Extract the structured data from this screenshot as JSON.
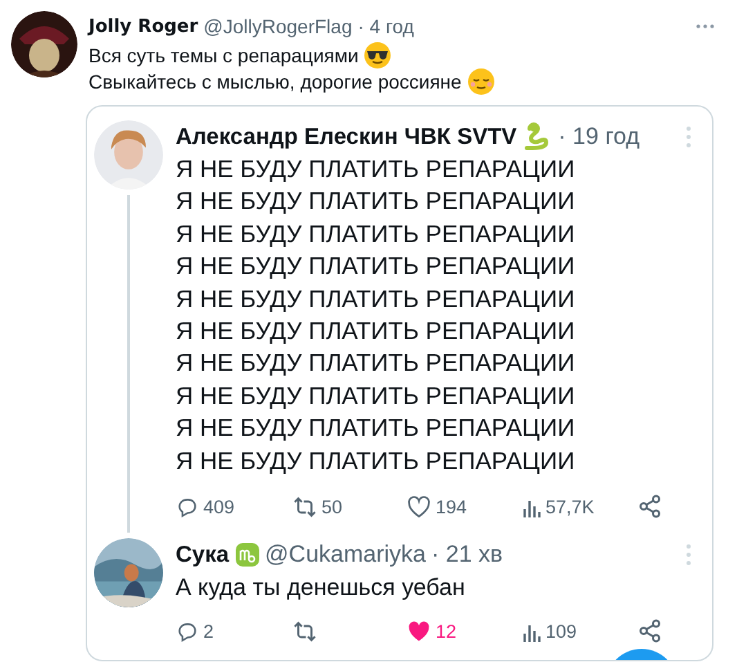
{
  "post": {
    "author": "Jolly Roger",
    "handle": "@JollyRogerFlag",
    "time": "· 4 год",
    "lines": [
      "Вся суть темы с репарациями",
      "Свыкайтесь с мыслью, дорогие россияне"
    ]
  },
  "quoted": {
    "author": "Александр Елескин ЧВК SVTV",
    "time": "· 19 год",
    "lines": [
      "Я НЕ БУДУ ПЛАТИТЬ РЕПАРАЦИИ",
      "Я НЕ БУДУ ПЛАТИТЬ РЕПАРАЦИИ",
      "Я НЕ БУДУ ПЛАТИТЬ РЕПАРАЦИИ",
      "Я НЕ БУДУ ПЛАТИТЬ РЕПАРАЦИИ",
      "Я НЕ БУДУ ПЛАТИТЬ РЕПАРАЦИИ",
      "Я НЕ БУДУ ПЛАТИТЬ РЕПАРАЦИИ",
      "Я НЕ БУДУ ПЛАТИТЬ РЕПАРАЦИИ",
      "Я НЕ БУДУ ПЛАТИТЬ РЕПАРАЦИИ",
      "Я НЕ БУДУ ПЛАТИТЬ РЕПАРАЦИИ",
      "Я НЕ БУДУ ПЛАТИТЬ РЕПАРАЦИИ"
    ],
    "actions": {
      "replies": "409",
      "reposts": "50",
      "likes": "194",
      "views": "57,7K",
      "liked": false
    }
  },
  "reply": {
    "author": "Сука",
    "handle": "@Cukamariyka",
    "time": "· 21 хв",
    "text": "А куда ты денешься уебан",
    "actions": {
      "replies": "2",
      "likes": "12",
      "views": "109",
      "liked": true
    }
  }
}
